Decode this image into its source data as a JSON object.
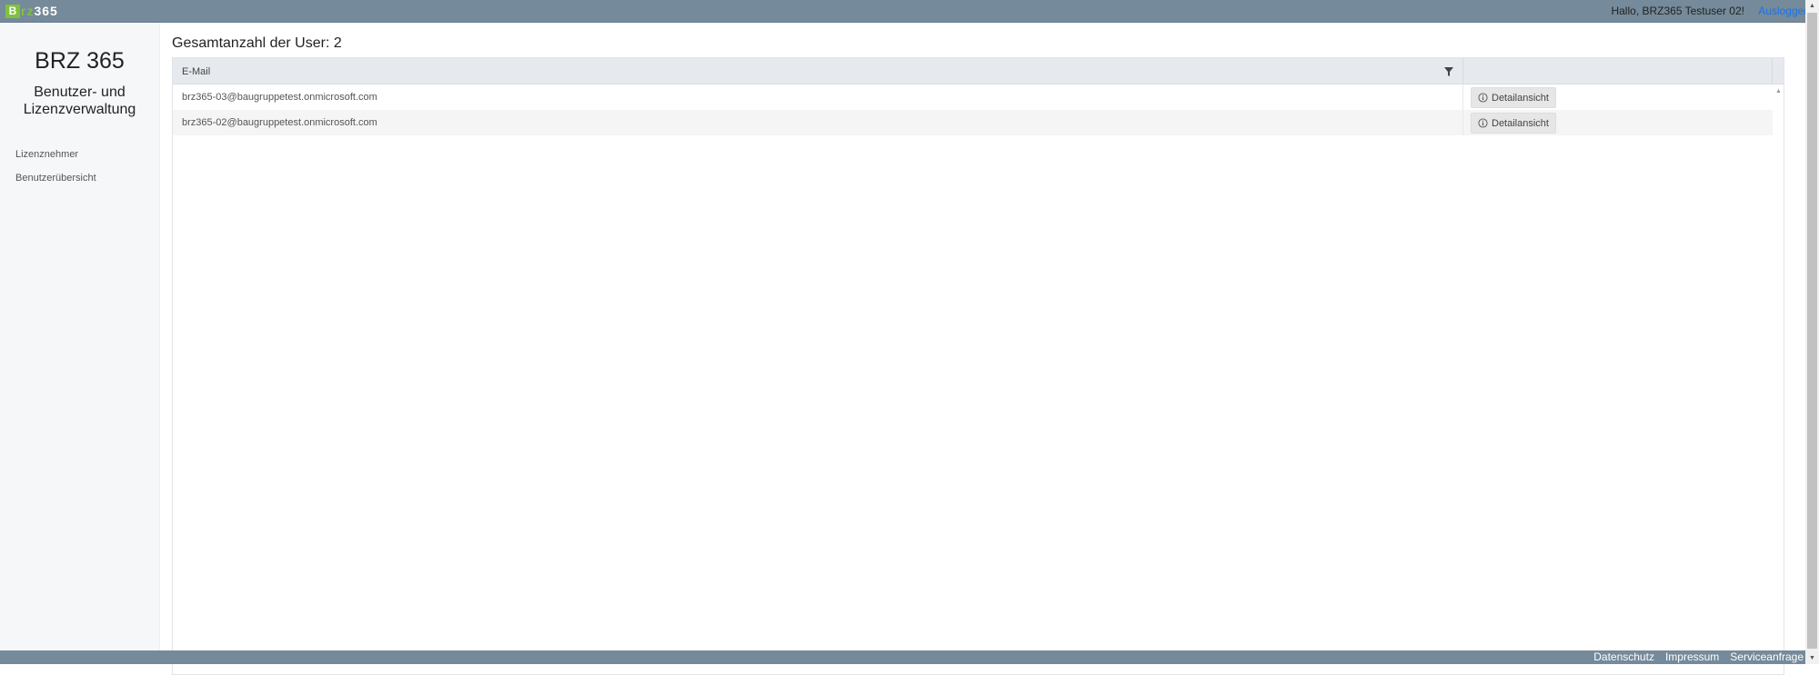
{
  "header": {
    "logo_mark": "B",
    "logo_text_a": "rz",
    "logo_text_b": "365",
    "greeting": "Hallo, BRZ365 Testuser 02!",
    "logout": "Ausloggen"
  },
  "sidebar": {
    "title": "BRZ 365",
    "subtitle_line1": "Benutzer- und",
    "subtitle_line2": "Lizenzverwaltung",
    "items": [
      {
        "label": "Lizenznehmer"
      },
      {
        "label": "Benutzerübersicht"
      }
    ]
  },
  "main": {
    "title": "Gesamtanzahl der User: 2",
    "table": {
      "columns": [
        "E-Mail",
        ""
      ],
      "rows": [
        {
          "email": "brz365-03@baugruppetest.onmicrosoft.com",
          "action": "Detailansicht"
        },
        {
          "email": "brz365-02@baugruppetest.onmicrosoft.com",
          "action": "Detailansicht"
        }
      ]
    }
  },
  "footer": {
    "links": [
      "Datenschutz",
      "Impressum",
      "Serviceanfrage"
    ]
  },
  "colors": {
    "topbar": "#758a9a",
    "brand_green": "#7ec23b",
    "link_blue": "#1a73e8"
  },
  "icons": {
    "filter": "filter-icon",
    "info": "info-icon"
  }
}
